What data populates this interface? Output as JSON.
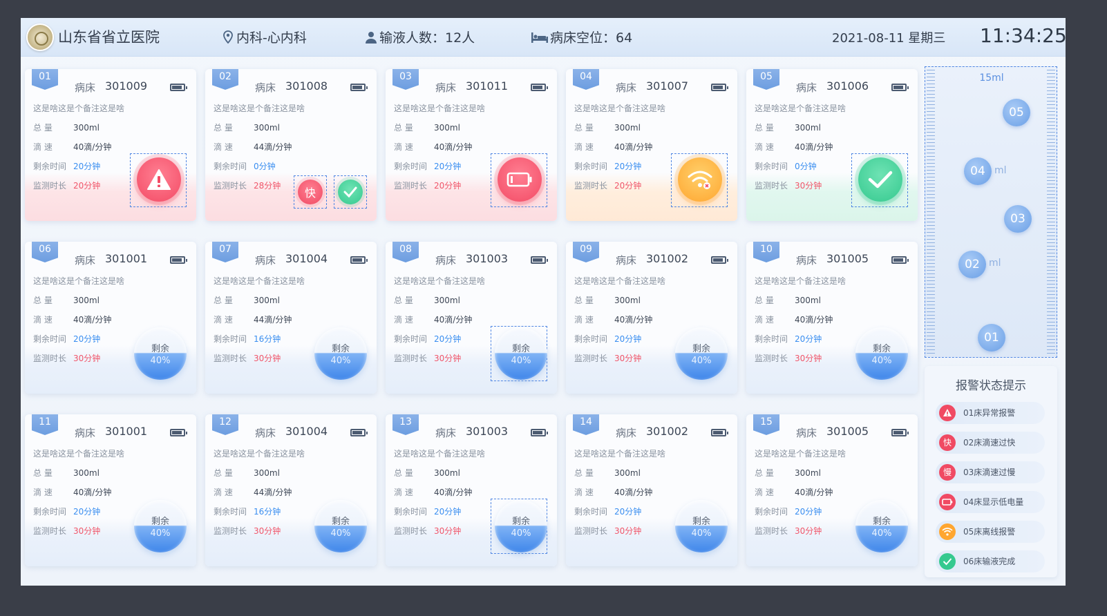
{
  "header": {
    "hospital": "山东省省立医院",
    "department": "内科-心内科",
    "infusion_count": "输液人数：12人",
    "empty_beds": "病床空位：64",
    "date": "2021-08-11 星期三",
    "time": "11:34:25"
  },
  "labels": {
    "bed": "病床",
    "total": "总   量",
    "rate": "滴   速",
    "remaining_time": "剩余时间",
    "monitor_time": "监测时长",
    "remain": "剩余",
    "fast": "快"
  },
  "cards": [
    {
      "num": "01",
      "bed": "301009",
      "note": "这是啥这是个备注这是啥",
      "total": "300ml",
      "rate": "40滴/分钟",
      "remain_time": "20分钟",
      "monitor": "20分钟",
      "status": "alarm"
    },
    {
      "num": "02",
      "bed": "301008",
      "note": "这是啥这是个备注这是啥",
      "total": "300ml",
      "rate": "44滴/分钟",
      "remain_time": "0分钟",
      "monitor": "28分钟",
      "status": "fast"
    },
    {
      "num": "03",
      "bed": "301011",
      "note": "这是啥这是个备注这是啥",
      "total": "300ml",
      "rate": "40滴/分钟",
      "remain_time": "20分钟",
      "monitor": "20分钟",
      "status": "battery"
    },
    {
      "num": "04",
      "bed": "301007",
      "note": "这是啥这是个备注这是啥",
      "total": "300ml",
      "rate": "40滴/分钟",
      "remain_time": "20分钟",
      "monitor": "20分钟",
      "status": "offline"
    },
    {
      "num": "05",
      "bed": "301006",
      "note": "这是啥这是个备注这是啥",
      "total": "300ml",
      "rate": "40滴/分钟",
      "remain_time": "0分钟",
      "monitor": "30分钟",
      "status": "done"
    },
    {
      "num": "06",
      "bed": "301001",
      "note": "这是啥这是个备注这是啥",
      "total": "300ml",
      "rate": "40滴/分钟",
      "remain_time": "20分钟",
      "monitor": "30分钟",
      "status": "normal",
      "remain_pct": "40%"
    },
    {
      "num": "07",
      "bed": "301004",
      "note": "这是啥这是个备注这是啥",
      "total": "300ml",
      "rate": "44滴/分钟",
      "remain_time": "16分钟",
      "monitor": "30分钟",
      "status": "normal",
      "remain_pct": "40%"
    },
    {
      "num": "08",
      "bed": "301003",
      "note": "这是啥这是个备注这是啥",
      "total": "300ml",
      "rate": "40滴/分钟",
      "remain_time": "20分钟",
      "monitor": "30分钟",
      "status": "normal",
      "remain_pct": "40%"
    },
    {
      "num": "09",
      "bed": "301002",
      "note": "这是啥这是个备注这是啥",
      "total": "300ml",
      "rate": "40滴/分钟",
      "remain_time": "20分钟",
      "monitor": "30分钟",
      "status": "normal",
      "remain_pct": "40%"
    },
    {
      "num": "10",
      "bed": "301005",
      "note": "这是啥这是个备注这是啥",
      "total": "300ml",
      "rate": "40滴/分钟",
      "remain_time": "20分钟",
      "monitor": "30分钟",
      "status": "normal",
      "remain_pct": "40%"
    },
    {
      "num": "11",
      "bed": "301001",
      "note": "这是啥这是个备注这是啥",
      "total": "300ml",
      "rate": "40滴/分钟",
      "remain_time": "20分钟",
      "monitor": "30分钟",
      "status": "normal",
      "remain_pct": "40%"
    },
    {
      "num": "12",
      "bed": "301004",
      "note": "这是啥这是个备注这是啥",
      "total": "300ml",
      "rate": "44滴/分钟",
      "remain_time": "16分钟",
      "monitor": "30分钟",
      "status": "normal",
      "remain_pct": "40%"
    },
    {
      "num": "13",
      "bed": "301003",
      "note": "这是啥这是个备注这是啥",
      "total": "300ml",
      "rate": "40滴/分钟",
      "remain_time": "20分钟",
      "monitor": "30分钟",
      "status": "normal",
      "remain_pct": "40%"
    },
    {
      "num": "14",
      "bed": "301002",
      "note": "这是啥这是个备注这是啥",
      "total": "300ml",
      "rate": "40滴/分钟",
      "remain_time": "20分钟",
      "monitor": "30分钟",
      "status": "normal",
      "remain_pct": "40%"
    },
    {
      "num": "15",
      "bed": "301005",
      "note": "这是啥这是个备注这是啥",
      "total": "300ml",
      "rate": "40滴/分钟",
      "remain_time": "20分钟",
      "monitor": "30分钟",
      "status": "normal",
      "remain_pct": "40%"
    }
  ],
  "gauge": {
    "top_label": "15ml",
    "drops": [
      "05",
      "04",
      "03",
      "02",
      "01"
    ],
    "tick_labels": [
      "ml",
      "ml"
    ]
  },
  "legend": {
    "title": "报警状态提示",
    "items": [
      {
        "text": "01床异常报警",
        "icon": "warning-icon",
        "color": "#f04a63"
      },
      {
        "text": "02床滴速过快",
        "icon": "fast-icon",
        "glyph": "快",
        "color": "#f04a63"
      },
      {
        "text": "03床滴速过慢",
        "icon": "slow-icon",
        "glyph": "慢",
        "color": "#f04a63"
      },
      {
        "text": "04床显示低电量",
        "icon": "battery-icon",
        "color": "#f04a63"
      },
      {
        "text": "05床离线报警",
        "icon": "wifi-off-icon",
        "color": "#ffa630"
      },
      {
        "text": "06床输液完成",
        "icon": "check-icon",
        "color": "#35c98f"
      }
    ]
  },
  "colors": {
    "accent": "#3a8ef0",
    "alarm": "#f04a63",
    "warning": "#ffa630",
    "ok": "#35c98f"
  }
}
